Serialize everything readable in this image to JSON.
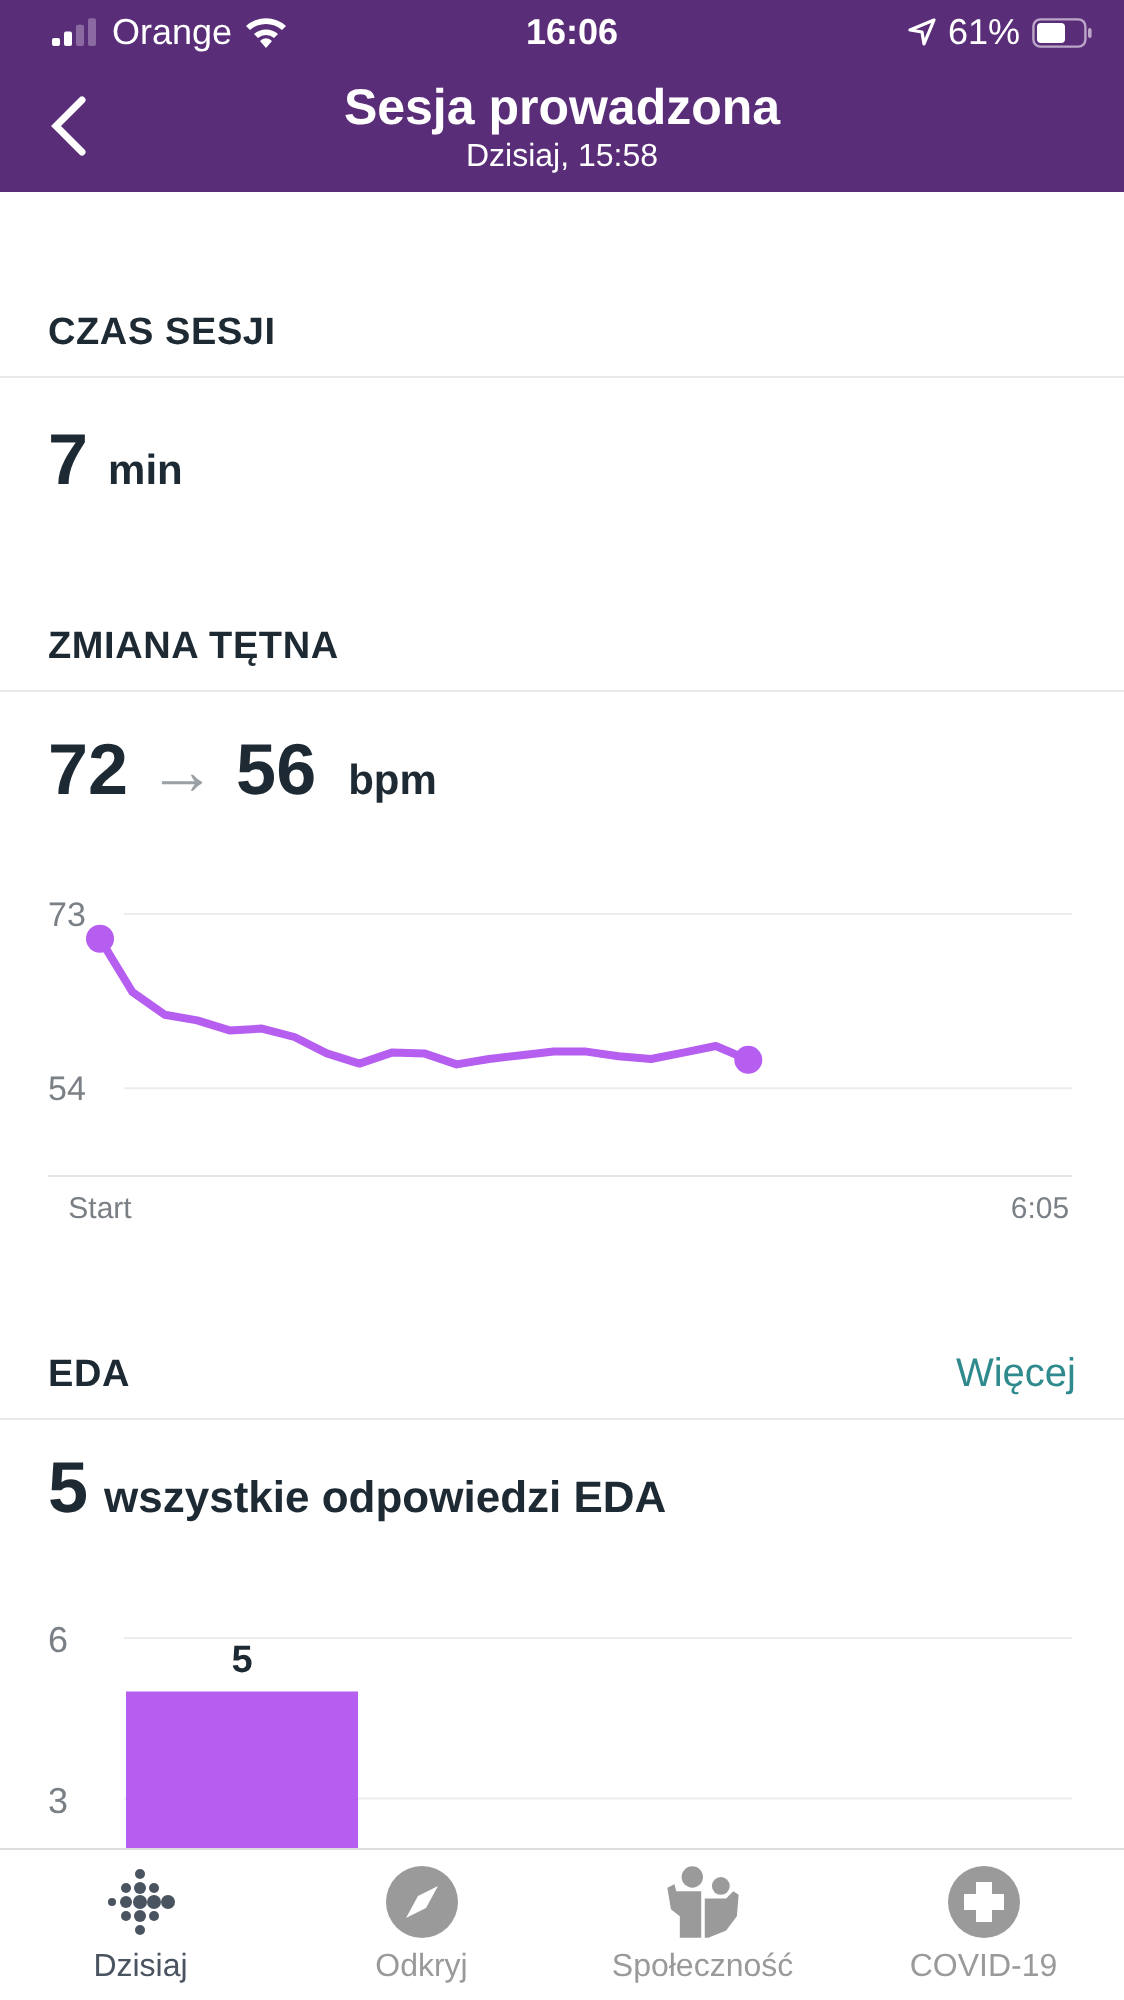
{
  "status_bar": {
    "carrier": "Orange",
    "time": "16:06",
    "battery": "61%"
  },
  "header": {
    "title": "Sesja prowadzona",
    "subtitle": "Dzisiaj, 15:58"
  },
  "session_time": {
    "heading": "CZAS SESJI",
    "value": "7",
    "unit": "min"
  },
  "heart_rate": {
    "heading": "ZMIANA TĘTNA",
    "from": "72",
    "arrow": "→",
    "to": "56",
    "unit": "bpm",
    "chart_data": {
      "type": "line",
      "ylim": [
        44,
        73
      ],
      "yticks": [
        73,
        54
      ],
      "categories": [
        "Start",
        null,
        null,
        null,
        null,
        null,
        null,
        null,
        null,
        null,
        null,
        null,
        null,
        null,
        null,
        null,
        null,
        null,
        null,
        null,
        null,
        null,
        null,
        null,
        null,
        null,
        null,
        null,
        null,
        "6:05"
      ],
      "series": [
        {
          "color": "#b55ef0",
          "values": [
            70.3,
            64.5,
            62.0,
            61.4,
            60.3,
            60.5,
            59.6,
            57.8,
            56.7,
            57.9,
            57.8,
            56.6,
            57.2,
            57.6,
            58.0,
            58.0,
            57.5,
            57.2,
            57.9,
            58.6,
            57.1,
            null,
            null,
            null,
            null,
            null,
            null,
            null,
            null,
            null
          ]
        }
      ]
    }
  },
  "eda": {
    "heading": "EDA",
    "link": "Więcej",
    "value": "5",
    "text": "wszystkie odpowiedzi EDA",
    "chart_data": {
      "type": "bar",
      "ylim": [
        2,
        6
      ],
      "yticks": [
        6,
        3
      ],
      "data_labels": true,
      "series": [
        {
          "color": "#b55ef0",
          "values": [
            5
          ]
        }
      ]
    }
  },
  "tabs": [
    {
      "label": "Dzisiaj",
      "kind": "dots",
      "selected": true
    },
    {
      "label": "Odkryj",
      "kind": "compass",
      "selected": false
    },
    {
      "label": "Społeczność",
      "kind": "people",
      "selected": false
    },
    {
      "label": "COVID-19",
      "kind": "plus",
      "selected": false
    }
  ]
}
